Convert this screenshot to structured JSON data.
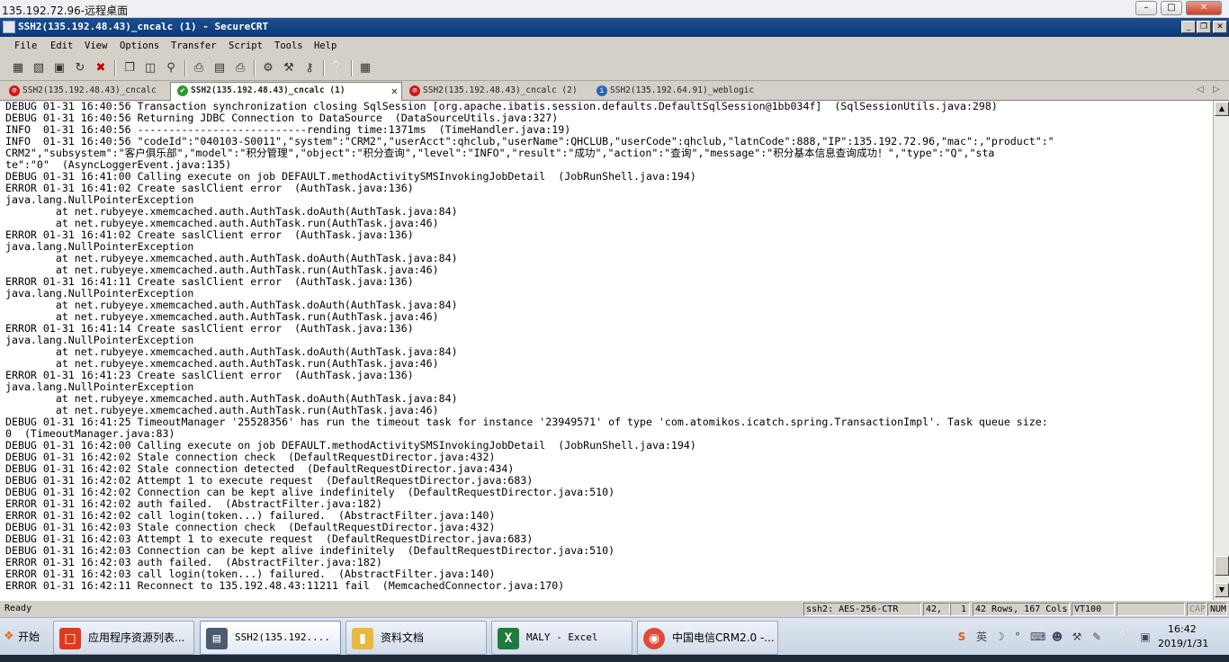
{
  "rdp": {
    "title": "135.192.72.96-远程桌面",
    "minimize": "–",
    "restore": "□",
    "close": "✕"
  },
  "window": {
    "title": "SSH2(135.192.48.43)_cncalc (1) - SecureCRT",
    "minimize": "_",
    "restore": "❐",
    "close": "✕"
  },
  "menu": [
    "File",
    "Edit",
    "View",
    "Options",
    "Transfer",
    "Script",
    "Tools",
    "Help"
  ],
  "toolbar_icons": [
    "connect-icon",
    "quick-connect-icon",
    "connect-tab-icon",
    "reconnect-icon",
    "disconnect-icon",
    "copy-icon",
    "paste-icon",
    "find-icon",
    "print-icon",
    "print-selection-icon",
    "printer-icon",
    "session-options-icon",
    "global-options-icon",
    "keymap-icon",
    "help-icon",
    "sftp-icon"
  ],
  "tabs": [
    {
      "label": "SSH2(135.192.48.43)_cncalc",
      "status": "error",
      "icon_color": "#d01818"
    },
    {
      "label": "SSH2(135.192.48.43)_cncalc (1)",
      "status": "connected",
      "icon_color": "#2e9a2e",
      "close": "✕"
    },
    {
      "label": "SSH2(135.192.48.43)_cncalc (2)",
      "status": "error",
      "icon_color": "#d01818"
    },
    {
      "label": "SSH2(135.192.64.91)_weblogic",
      "status": "info",
      "icon_color": "#2a63b8"
    }
  ],
  "tab_nav": {
    "prev": "◁",
    "next": "▷"
  },
  "terminal": {
    "lines": [
      "DEBUG 01-31 16:40:56 Transaction synchronization closing SqlSession [org.apache.ibatis.session.defaults.DefaultSqlSession@1bb034f]  (SqlSessionUtils.java:298)",
      "DEBUG 01-31 16:40:56 Returning JDBC Connection to DataSource  (DataSourceUtils.java:327)",
      "INFO  01-31 16:40:56 ---------------------------rending time:1371ms  (TimeHandler.java:19)",
      "INFO  01-31 16:40:56 \"codeId\":\"040103-S0011\",\"system\":\"CRM2\",\"userAcct\":qhclub,\"userName\":QHCLUB,\"userCode\":qhclub,\"latnCode\":888,\"IP\":135.192.72.96,\"mac\":,\"product\":\"",
      "CRM2\",\"subsystem\":\"客户俱乐部\",\"model\":\"积分管理\",\"object\":\"积分查询\",\"level\":\"INFO\",\"result\":\"成功\",\"action\":\"查询\",\"message\":\"积分基本信息查询成功！\",\"type\":\"Q\",\"sta",
      "te\":\"0\"  (AsyncLoggerEvent.java:135)",
      "DEBUG 01-31 16:41:00 Calling execute on job DEFAULT.methodActivitySMSInvokingJobDetail  (JobRunShell.java:194)",
      "ERROR 01-31 16:41:02 Create saslClient error  (AuthTask.java:136)",
      "java.lang.NullPointerException",
      "        at net.rubyeye.xmemcached.auth.AuthTask.doAuth(AuthTask.java:84)",
      "        at net.rubyeye.xmemcached.auth.AuthTask.run(AuthTask.java:46)",
      "ERROR 01-31 16:41:02 Create saslClient error  (AuthTask.java:136)",
      "java.lang.NullPointerException",
      "        at net.rubyeye.xmemcached.auth.AuthTask.doAuth(AuthTask.java:84)",
      "        at net.rubyeye.xmemcached.auth.AuthTask.run(AuthTask.java:46)",
      "ERROR 01-31 16:41:11 Create saslClient error  (AuthTask.java:136)",
      "java.lang.NullPointerException",
      "        at net.rubyeye.xmemcached.auth.AuthTask.doAuth(AuthTask.java:84)",
      "        at net.rubyeye.xmemcached.auth.AuthTask.run(AuthTask.java:46)",
      "ERROR 01-31 16:41:14 Create saslClient error  (AuthTask.java:136)",
      "java.lang.NullPointerException",
      "        at net.rubyeye.xmemcached.auth.AuthTask.doAuth(AuthTask.java:84)",
      "        at net.rubyeye.xmemcached.auth.AuthTask.run(AuthTask.java:46)",
      "ERROR 01-31 16:41:23 Create saslClient error  (AuthTask.java:136)",
      "java.lang.NullPointerException",
      "        at net.rubyeye.xmemcached.auth.AuthTask.doAuth(AuthTask.java:84)",
      "        at net.rubyeye.xmemcached.auth.AuthTask.run(AuthTask.java:46)",
      "DEBUG 01-31 16:41:25 TimeoutManager '25528356' has run the timeout task for instance '23949571' of type 'com.atomikos.icatch.spring.TransactionImpl'. Task queue size:",
      "0  (TimeoutManager.java:83)",
      "DEBUG 01-31 16:42:00 Calling execute on job DEFAULT.methodActivitySMSInvokingJobDetail  (JobRunShell.java:194)",
      "DEBUG 01-31 16:42:02 Stale connection check  (DefaultRequestDirector.java:432)",
      "DEBUG 01-31 16:42:02 Stale connection detected  (DefaultRequestDirector.java:434)",
      "DEBUG 01-31 16:42:02 Attempt 1 to execute request  (DefaultRequestDirector.java:683)",
      "DEBUG 01-31 16:42:02 Connection can be kept alive indefinitely  (DefaultRequestDirector.java:510)",
      "ERROR 01-31 16:42:02 auth failed.  (AbstractFilter.java:182)",
      "ERROR 01-31 16:42:02 call login(token...) failured.  (AbstractFilter.java:140)",
      "DEBUG 01-31 16:42:03 Stale connection check  (DefaultRequestDirector.java:432)",
      "DEBUG 01-31 16:42:03 Attempt 1 to execute request  (DefaultRequestDirector.java:683)",
      "DEBUG 01-31 16:42:03 Connection can be kept alive indefinitely  (DefaultRequestDirector.java:510)",
      "ERROR 01-31 16:42:03 auth failed.  (AbstractFilter.java:182)",
      "ERROR 01-31 16:42:03 call login(token...) failured.  (AbstractFilter.java:140)",
      "ERROR 01-31 16:42:11 Reconnect to 135.192.48.43:11211 fail  (MemcachedConnector.java:170)"
    ],
    "scroll_up": "▲",
    "scroll_down": "▼"
  },
  "statusbar": {
    "ready": "Ready",
    "cipher": "ssh2: AES-256-CTR",
    "row": "42,",
    "col": "1",
    "size": "42 Rows, 167 Cols",
    "emulation": "VT100",
    "cap": "CAP",
    "num": "NUM"
  },
  "taskbar": {
    "start": "开始",
    "items": [
      {
        "label": "应用程序资源列表...",
        "icon_color": "#e03a1e",
        "active": false
      },
      {
        "label": "SSH2(135.192....",
        "icon_color": "#4d5b70",
        "active": true
      },
      {
        "label": "资料文档",
        "icon_color": "#e7b93f",
        "active": false
      },
      {
        "label": "MALY - Excel",
        "icon_color": "#1e7b3c",
        "active": false
      },
      {
        "label": "中国电信CRM2.0 -...",
        "icon_color": "#dd4b39",
        "active": false
      }
    ],
    "tray_icons": [
      "sogou-icon",
      "language-icon",
      "moon-icon",
      "punctuation-icon",
      "keyboard-icon",
      "user-icon",
      "tools-icon",
      "edit-icon",
      "help-icon",
      "network-icon"
    ],
    "time": "16:42",
    "date": "2019/1/31"
  }
}
